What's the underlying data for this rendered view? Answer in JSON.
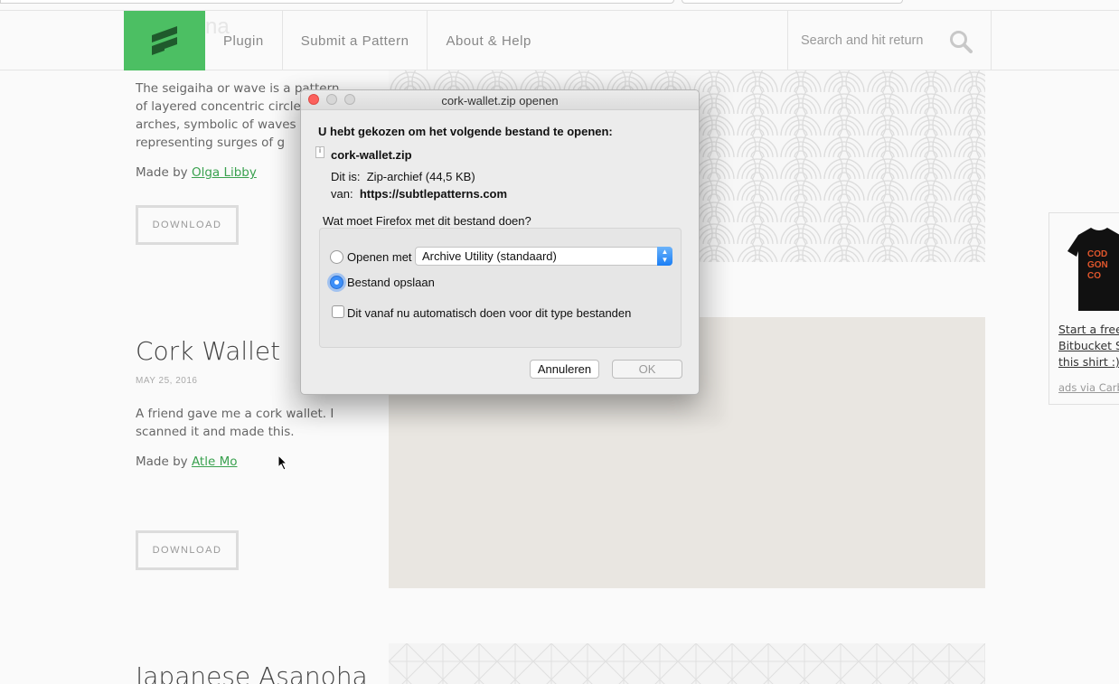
{
  "header": {
    "logo_ghost_text": "na",
    "nav": [
      "Plugin",
      "Submit a Pattern",
      "About & Help"
    ],
    "search_placeholder": "Search and hit return"
  },
  "patterns": [
    {
      "description": "The seigaiha or wave is a pattern of layered concentric circles cre arches, symbolic of waves o and representing surges of g",
      "made_by_prefix": "Made by ",
      "author": "Olga Libby",
      "download_label": "DOWNLOAD"
    },
    {
      "title": "Cork Wallet",
      "date": "MAY 25, 2016",
      "description": "A friend gave me a cork wallet. I scanned it and made this.",
      "made_by_prefix": "Made by ",
      "author": "Atle Mo",
      "download_label": "DOWNLOAD"
    },
    {
      "title": "Japanese Asanoha"
    }
  ],
  "ad": {
    "lines": [
      "Start a free t",
      "Bitbucket Se",
      "this shirt :)"
    ],
    "via": "ads via Carb"
  },
  "dialog": {
    "title": "cork-wallet.zip openen",
    "heading": "U hebt gekozen om het volgende bestand te openen:",
    "filename": "cork-wallet.zip",
    "type_prefix": "Dit is:",
    "type_value": "Zip-archief (44,5 KB)",
    "from_prefix": "van:",
    "from_value": "https://subtlepatterns.com",
    "question": "Wat moet Firefox met dit bestand doen?",
    "open_with_label": "Openen met",
    "open_with_app": "Archive Utility (standaard)",
    "save_label": "Bestand opslaan",
    "auto_label": "Dit vanaf nu automatisch doen voor dit type bestanden",
    "cancel_label": "Annuleren",
    "ok_label": "OK",
    "selected_option": "save"
  },
  "colors": {
    "brand_green": "#4cbf63",
    "link_green": "#3aa14f",
    "mac_blue": "#3d8ff8"
  }
}
